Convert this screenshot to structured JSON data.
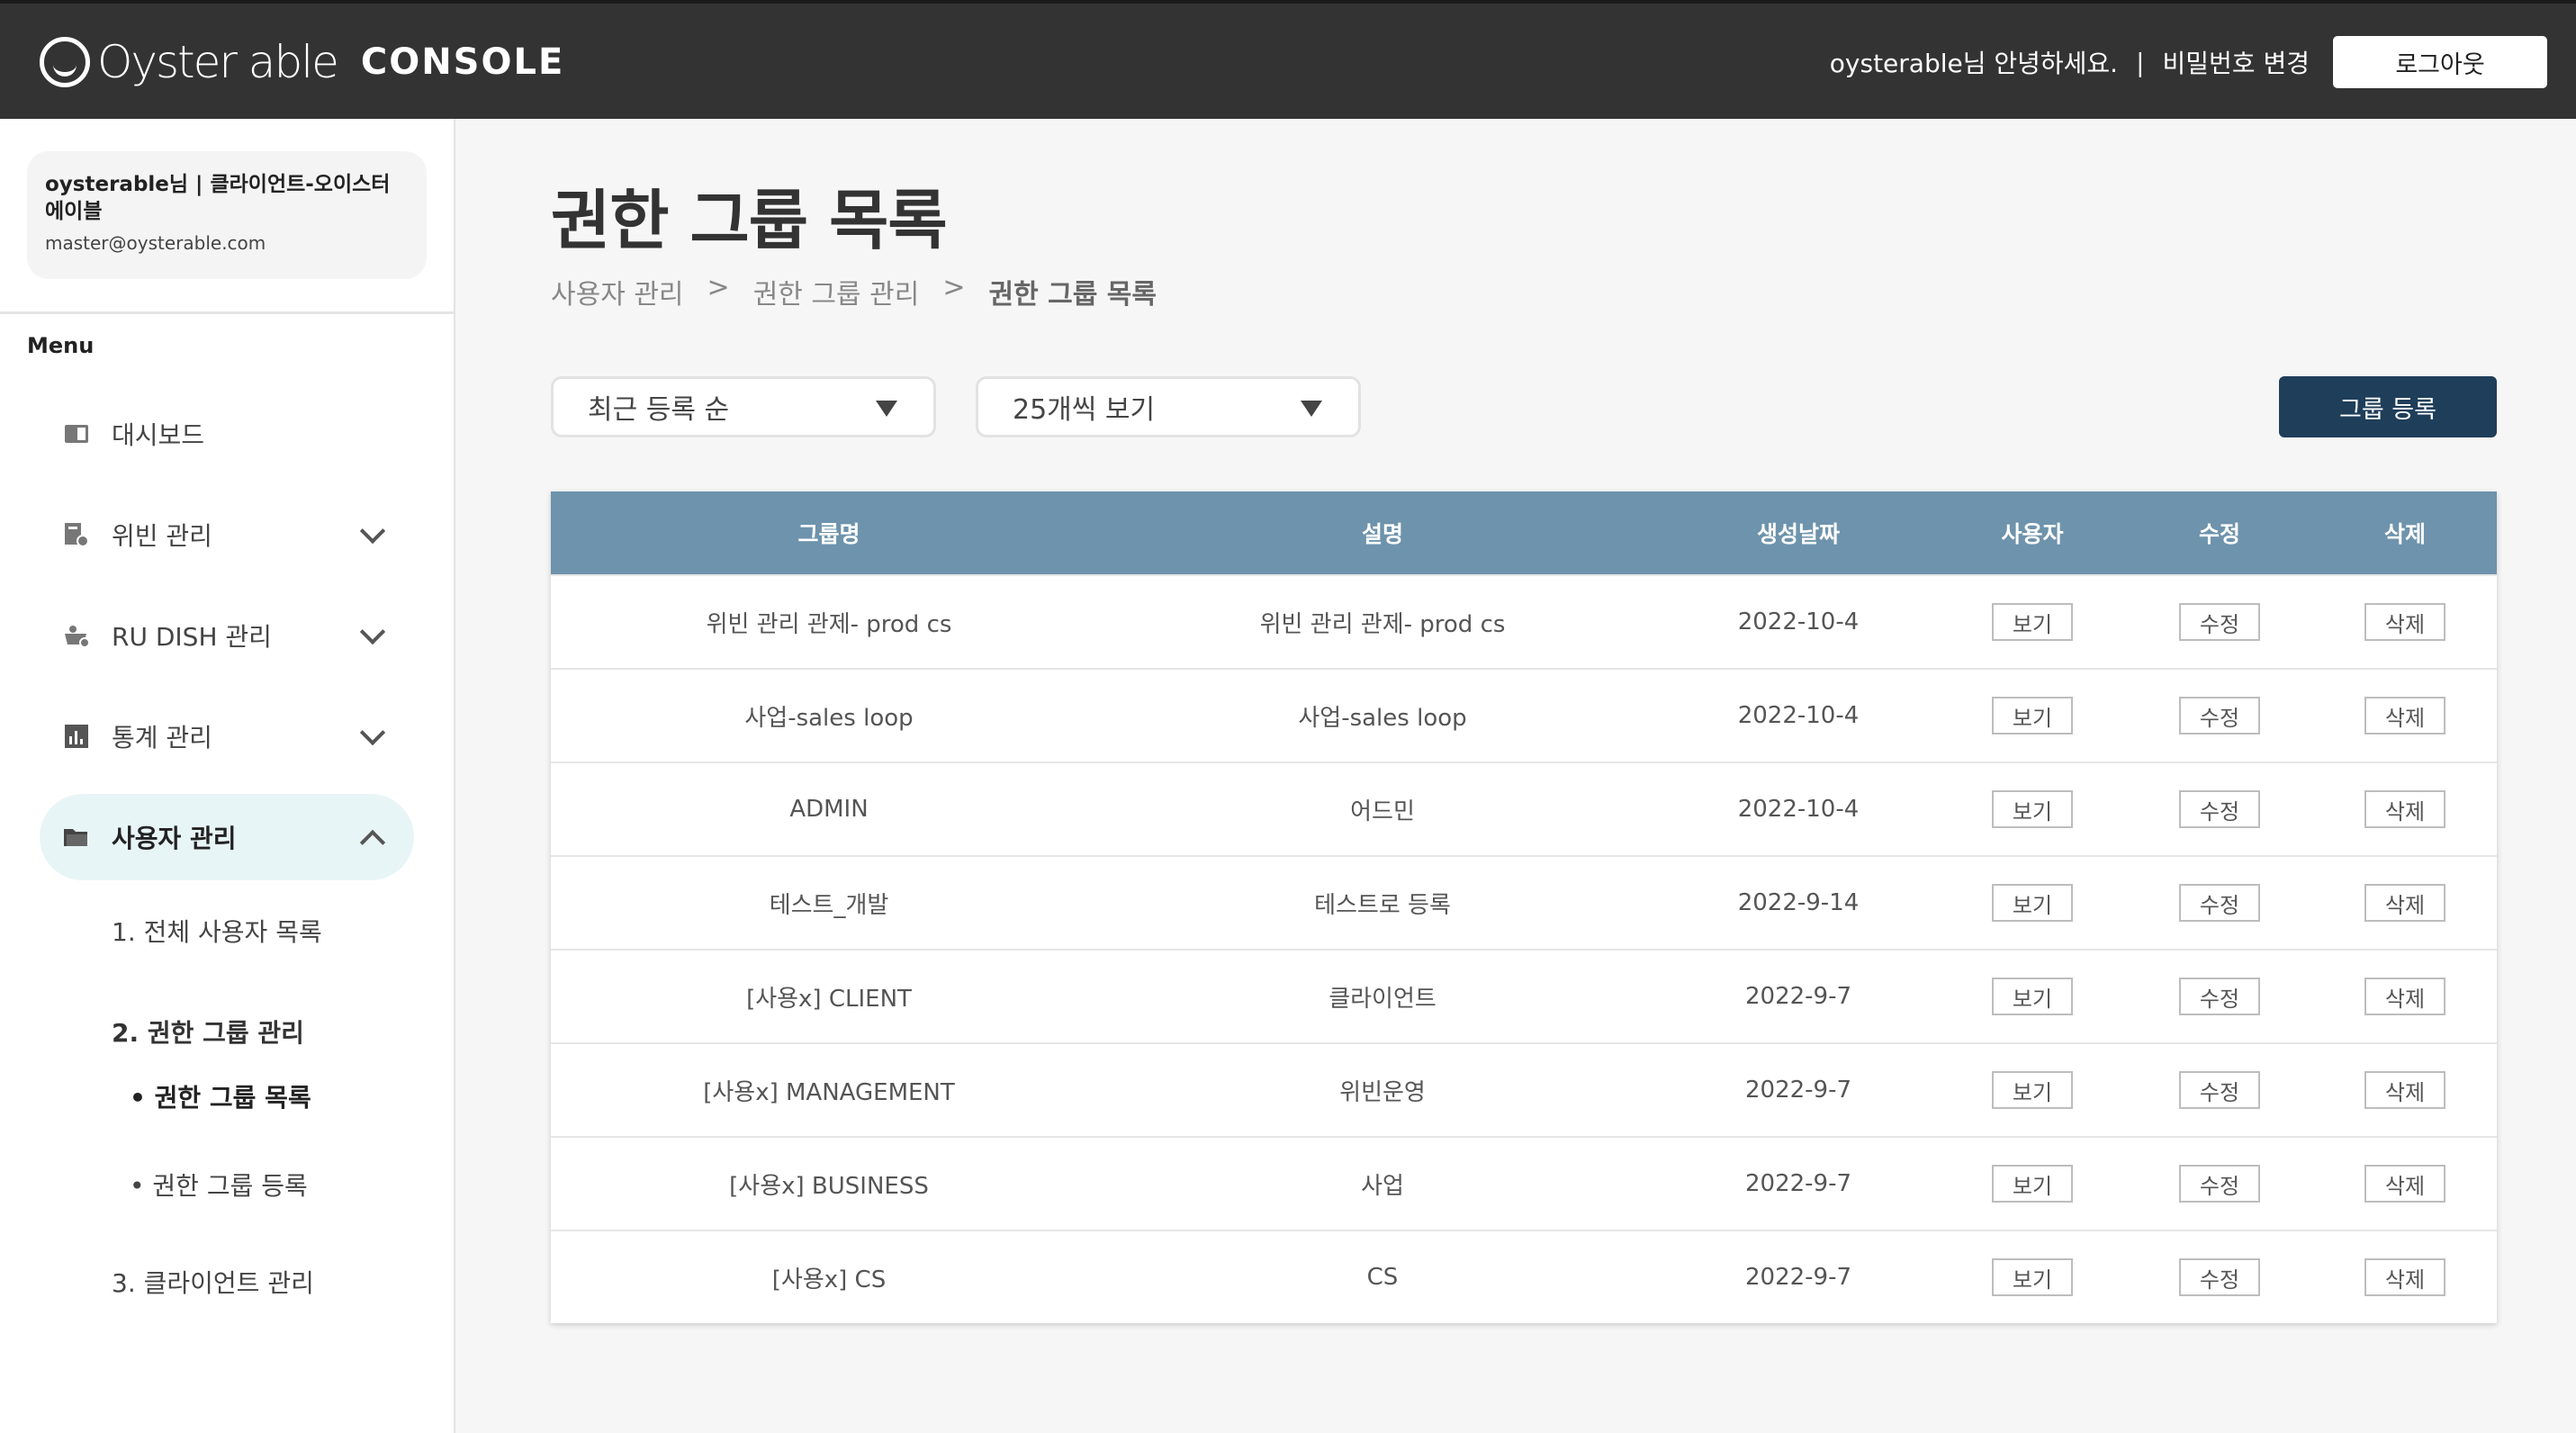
{
  "header": {
    "logo_text": "Oyster able",
    "console_label": "CONSOLE",
    "greeting": "oysterable님 안녕하세요.",
    "separator": "|",
    "change_password": "비밀번호 변경",
    "logout": "로그아웃"
  },
  "sidebar": {
    "profile": {
      "name": "oysterable님 | 클라이언트-오이스터에이블",
      "email": "master@oysterable.com"
    },
    "menu_heading": "Menu",
    "items": [
      {
        "label": "대시보드",
        "icon": "dashboard-icon"
      },
      {
        "label": "위빈 관리",
        "icon": "bin-settings-icon"
      },
      {
        "label": "RU DISH 관리",
        "icon": "dish-icon"
      },
      {
        "label": "통계 관리",
        "icon": "chart-icon"
      },
      {
        "label": "사용자 관리",
        "icon": "folder-icon"
      }
    ],
    "sub_items": [
      {
        "label": "1. 전체 사용자 목록"
      },
      {
        "label": "2. 권한 그룹 관리"
      },
      {
        "label": "3. 클라이언트 관리"
      }
    ],
    "subsub_items": [
      {
        "label": "• 권한 그룹 목록"
      },
      {
        "label": "• 권한 그룹 등록"
      }
    ]
  },
  "main": {
    "title": "권한 그룹 목록",
    "breadcrumb": [
      "사용자 관리",
      "권한 그룹 관리",
      "권한 그룹 목록"
    ],
    "breadcrumb_sep": ">",
    "sort_select": "최근 등록 순",
    "page_size_select": "25개씩 보기",
    "register_button": "그룹 등록"
  },
  "table": {
    "columns": [
      "그룹명",
      "설명",
      "생성날짜",
      "사용자",
      "수정",
      "삭제"
    ],
    "view_label": "보기",
    "edit_label": "수정",
    "delete_label": "삭제",
    "rows": [
      {
        "name": "위빈 관리 관제- prod cs",
        "desc": "위빈 관리 관제- prod cs",
        "date": "2022-10-4"
      },
      {
        "name": "사업-sales loop",
        "desc": "사업-sales loop",
        "date": "2022-10-4"
      },
      {
        "name": "ADMIN",
        "desc": "어드민",
        "date": "2022-10-4"
      },
      {
        "name": "테스트_개발",
        "desc": "테스트로 등록",
        "date": "2022-9-14"
      },
      {
        "name": "[사용x] CLIENT",
        "desc": "클라이언트",
        "date": "2022-9-7"
      },
      {
        "name": "[사용x] MANAGEMENT",
        "desc": "위빈운영",
        "date": "2022-9-7"
      },
      {
        "name": "[사용x] BUSINESS",
        "desc": "사업",
        "date": "2022-9-7"
      },
      {
        "name": "[사용x] CS",
        "desc": "CS",
        "date": "2022-9-7"
      }
    ]
  }
}
